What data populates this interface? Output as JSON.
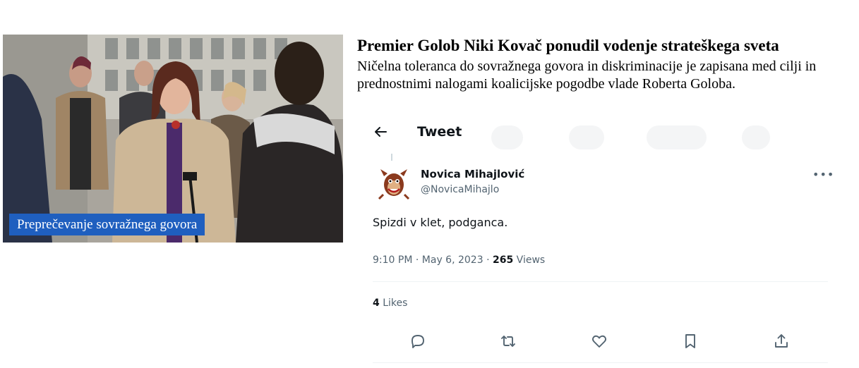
{
  "article": {
    "headline": "Premier Golob Niki Kovač ponudil vodenje strateškega sveta",
    "lead": "Ničelna toleranca do sovražnega govora in diskriminacije je zapisana med cilji in prednostnimi nalogami koalicijske pogodbe vlade Roberta Goloba.",
    "photo_caption": "Preprečevanje sovražnega govora"
  },
  "tweet": {
    "header_title": "Tweet",
    "back_icon": "arrow-left-icon",
    "author_name": "Novica Mihajlović",
    "author_handle": "@NovicaMihajlo",
    "text": "Spizdi v klet, podganca.",
    "time": "9:10 PM",
    "date": "May 6, 2023",
    "views_count": "265",
    "views_label": "Views",
    "likes_count": "4",
    "likes_label": "Likes",
    "actions": [
      "reply-icon",
      "retweet-icon",
      "like-icon",
      "bookmark-icon",
      "share-icon"
    ]
  },
  "colors": {
    "caption_bg": "#1f5fbf",
    "secondary_text": "#536471",
    "primary_text": "#0f1419"
  }
}
